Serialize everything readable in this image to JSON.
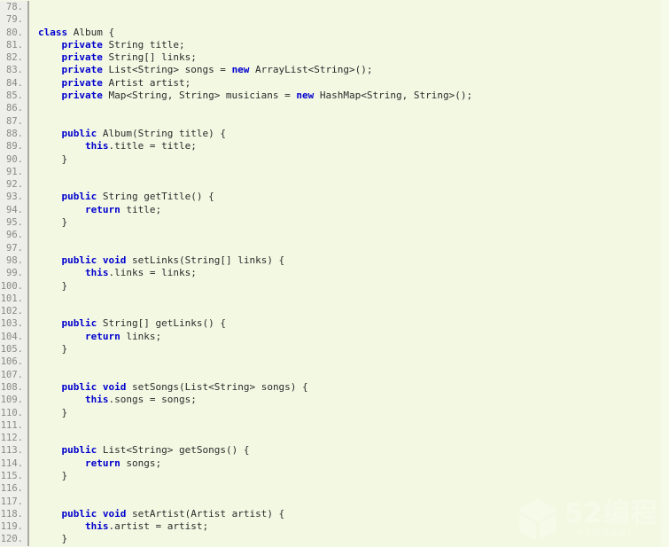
{
  "editor": {
    "language": "Java",
    "background_color": "#f3f8e3",
    "gutter_color": "#eeeeea",
    "gutter_text_color": "#8a8a84",
    "keyword_color": "#0000cd",
    "text_color": "#2b2b2b",
    "first_line_number": 78,
    "last_line_number": 120
  },
  "lines": [
    {
      "number": "78.",
      "tokens": []
    },
    {
      "number": "79.",
      "tokens": []
    },
    {
      "number": "80.",
      "tokens": [
        {
          "t": "kw",
          "s": "class"
        },
        {
          "t": "txt",
          "s": " Album {"
        }
      ]
    },
    {
      "number": "81.",
      "tokens": [
        {
          "t": "txt",
          "s": "    "
        },
        {
          "t": "kw",
          "s": "private"
        },
        {
          "t": "txt",
          "s": " String title;"
        }
      ]
    },
    {
      "number": "82.",
      "tokens": [
        {
          "t": "txt",
          "s": "    "
        },
        {
          "t": "kw",
          "s": "private"
        },
        {
          "t": "txt",
          "s": " String[] links;"
        }
      ]
    },
    {
      "number": "83.",
      "tokens": [
        {
          "t": "txt",
          "s": "    "
        },
        {
          "t": "kw",
          "s": "private"
        },
        {
          "t": "txt",
          "s": " List<String> songs = "
        },
        {
          "t": "kw",
          "s": "new"
        },
        {
          "t": "txt",
          "s": " ArrayList<String>();"
        }
      ]
    },
    {
      "number": "84.",
      "tokens": [
        {
          "t": "txt",
          "s": "    "
        },
        {
          "t": "kw",
          "s": "private"
        },
        {
          "t": "txt",
          "s": " Artist artist;"
        }
      ]
    },
    {
      "number": "85.",
      "tokens": [
        {
          "t": "txt",
          "s": "    "
        },
        {
          "t": "kw",
          "s": "private"
        },
        {
          "t": "txt",
          "s": " Map<String, String> musicians = "
        },
        {
          "t": "kw",
          "s": "new"
        },
        {
          "t": "txt",
          "s": " HashMap<String, String>();"
        }
      ]
    },
    {
      "number": "86.",
      "tokens": []
    },
    {
      "number": "87.",
      "tokens": []
    },
    {
      "number": "88.",
      "tokens": [
        {
          "t": "txt",
          "s": "    "
        },
        {
          "t": "kw",
          "s": "public"
        },
        {
          "t": "txt",
          "s": " Album(String title) {"
        }
      ]
    },
    {
      "number": "89.",
      "tokens": [
        {
          "t": "txt",
          "s": "        "
        },
        {
          "t": "kw",
          "s": "this"
        },
        {
          "t": "txt",
          "s": ".title = title;"
        }
      ]
    },
    {
      "number": "90.",
      "tokens": [
        {
          "t": "txt",
          "s": "    }"
        }
      ]
    },
    {
      "number": "91.",
      "tokens": []
    },
    {
      "number": "92.",
      "tokens": []
    },
    {
      "number": "93.",
      "tokens": [
        {
          "t": "txt",
          "s": "    "
        },
        {
          "t": "kw",
          "s": "public"
        },
        {
          "t": "txt",
          "s": " String getTitle() {"
        }
      ]
    },
    {
      "number": "94.",
      "tokens": [
        {
          "t": "txt",
          "s": "        "
        },
        {
          "t": "kw",
          "s": "return"
        },
        {
          "t": "txt",
          "s": " title;"
        }
      ]
    },
    {
      "number": "95.",
      "tokens": [
        {
          "t": "txt",
          "s": "    }"
        }
      ]
    },
    {
      "number": "96.",
      "tokens": []
    },
    {
      "number": "97.",
      "tokens": []
    },
    {
      "number": "98.",
      "tokens": [
        {
          "t": "txt",
          "s": "    "
        },
        {
          "t": "kw",
          "s": "public"
        },
        {
          "t": "txt",
          "s": " "
        },
        {
          "t": "kw",
          "s": "void"
        },
        {
          "t": "txt",
          "s": " setLinks(String[] links) {"
        }
      ]
    },
    {
      "number": "99.",
      "tokens": [
        {
          "t": "txt",
          "s": "        "
        },
        {
          "t": "kw",
          "s": "this"
        },
        {
          "t": "txt",
          "s": ".links = links;"
        }
      ]
    },
    {
      "number": "100.",
      "tokens": [
        {
          "t": "txt",
          "s": "    }"
        }
      ]
    },
    {
      "number": "101.",
      "tokens": []
    },
    {
      "number": "102.",
      "tokens": []
    },
    {
      "number": "103.",
      "tokens": [
        {
          "t": "txt",
          "s": "    "
        },
        {
          "t": "kw",
          "s": "public"
        },
        {
          "t": "txt",
          "s": " String[] getLinks() {"
        }
      ]
    },
    {
      "number": "104.",
      "tokens": [
        {
          "t": "txt",
          "s": "        "
        },
        {
          "t": "kw",
          "s": "return"
        },
        {
          "t": "txt",
          "s": " links;"
        }
      ]
    },
    {
      "number": "105.",
      "tokens": [
        {
          "t": "txt",
          "s": "    }"
        }
      ]
    },
    {
      "number": "106.",
      "tokens": []
    },
    {
      "number": "107.",
      "tokens": []
    },
    {
      "number": "108.",
      "tokens": [
        {
          "t": "txt",
          "s": "    "
        },
        {
          "t": "kw",
          "s": "public"
        },
        {
          "t": "txt",
          "s": " "
        },
        {
          "t": "kw",
          "s": "void"
        },
        {
          "t": "txt",
          "s": " setSongs(List<String> songs) {"
        }
      ]
    },
    {
      "number": "109.",
      "tokens": [
        {
          "t": "txt",
          "s": "        "
        },
        {
          "t": "kw",
          "s": "this"
        },
        {
          "t": "txt",
          "s": ".songs = songs;"
        }
      ]
    },
    {
      "number": "110.",
      "tokens": [
        {
          "t": "txt",
          "s": "    }"
        }
      ]
    },
    {
      "number": "111.",
      "tokens": []
    },
    {
      "number": "112.",
      "tokens": []
    },
    {
      "number": "113.",
      "tokens": [
        {
          "t": "txt",
          "s": "    "
        },
        {
          "t": "kw",
          "s": "public"
        },
        {
          "t": "txt",
          "s": " List<String> getSongs() {"
        }
      ]
    },
    {
      "number": "114.",
      "tokens": [
        {
          "t": "txt",
          "s": "        "
        },
        {
          "t": "kw",
          "s": "return"
        },
        {
          "t": "txt",
          "s": " songs;"
        }
      ]
    },
    {
      "number": "115.",
      "tokens": [
        {
          "t": "txt",
          "s": "    }"
        }
      ]
    },
    {
      "number": "116.",
      "tokens": []
    },
    {
      "number": "117.",
      "tokens": []
    },
    {
      "number": "118.",
      "tokens": [
        {
          "t": "txt",
          "s": "    "
        },
        {
          "t": "kw",
          "s": "public"
        },
        {
          "t": "txt",
          "s": " "
        },
        {
          "t": "kw",
          "s": "void"
        },
        {
          "t": "txt",
          "s": " setArtist(Artist artist) {"
        }
      ]
    },
    {
      "number": "119.",
      "tokens": [
        {
          "t": "txt",
          "s": "        "
        },
        {
          "t": "kw",
          "s": "this"
        },
        {
          "t": "txt",
          "s": ".artist = artist;"
        }
      ]
    },
    {
      "number": "120.",
      "tokens": [
        {
          "t": "txt",
          "s": "    }"
        }
      ]
    }
  ],
  "watermark": {
    "title": "52编程",
    "subtitle": "— 专注开发者成长 —",
    "logo_icon": "cube-logo-icon",
    "color": "#f9fcee"
  }
}
